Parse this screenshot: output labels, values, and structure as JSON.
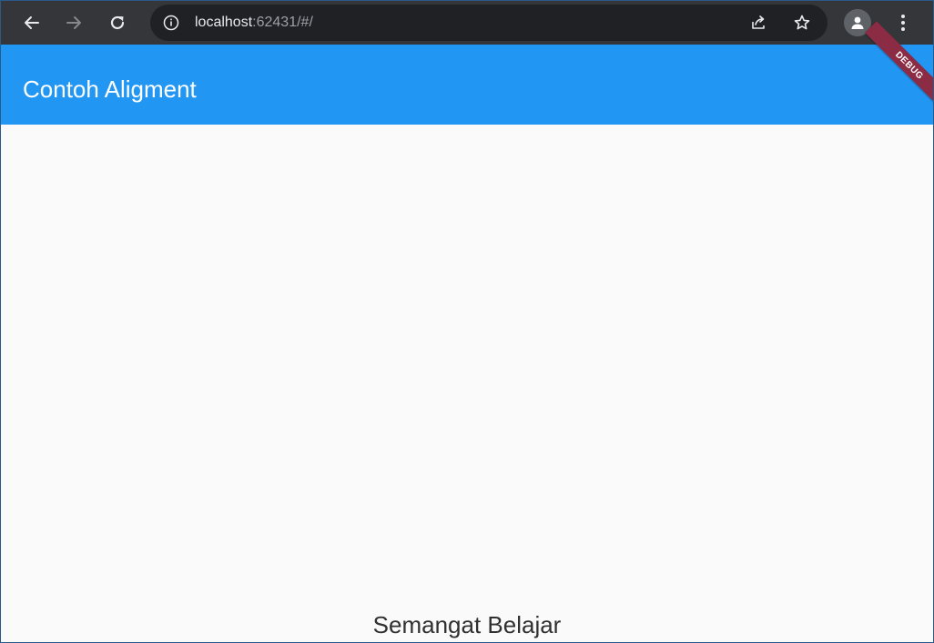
{
  "browser": {
    "url_host": "localhost",
    "url_rest": ":62431/#/",
    "icons": {
      "back": "back-arrow-icon",
      "forward": "forward-arrow-icon",
      "reload": "reload-icon",
      "site_info": "info-icon",
      "share": "share-icon",
      "bookmark": "star-icon",
      "profile": "person-icon",
      "menu": "kebab-menu-icon"
    },
    "colors": {
      "toolbar": "#35363a",
      "omnibox": "#202124"
    }
  },
  "app": {
    "title": "Contoh Aligment",
    "debug_label": "DEBUG",
    "body_text": "Semangat Belajar",
    "colors": {
      "appbar": "#2196f3",
      "background": "#fafafa",
      "debug_banner": "#8b2b44"
    }
  }
}
